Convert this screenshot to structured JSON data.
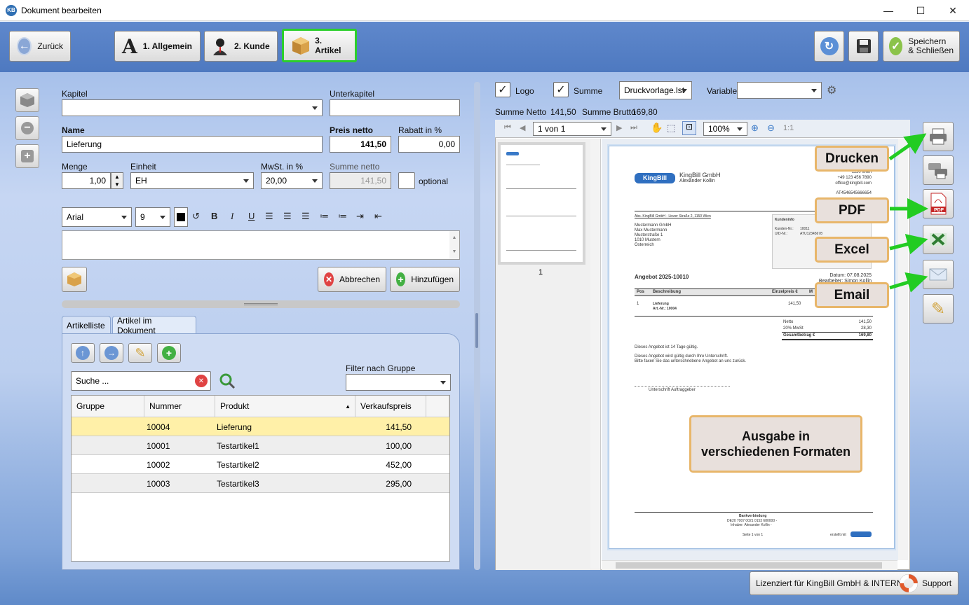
{
  "window": {
    "title": "Dokument bearbeiten",
    "app_icon": "KB",
    "min": "—",
    "max": "☐",
    "close": "✕"
  },
  "toolbar": {
    "back": "Zurück",
    "tab1": "1. Allgemein",
    "tab2": "2. Kunde",
    "tab3": "3. Artikel",
    "save_close": "Speichern\n& Schließen"
  },
  "form": {
    "kapitel_label": "Kapitel",
    "unterkapitel_label": "Unterkapitel",
    "name_label": "Name",
    "name_value": "Lieferung",
    "preis_label": "Preis netto",
    "preis_value": "141,50",
    "rabatt_label": "Rabatt in %",
    "rabatt_value": "0,00",
    "menge_label": "Menge",
    "menge_value": "1,00",
    "einheit_label": "Einheit",
    "einheit_value": "EH",
    "mwst_label": "MwSt. in %",
    "mwst_value": "20,00",
    "summe_label": "Summe netto",
    "summe_value": "141,50",
    "optional_label": "optional",
    "font_value": "Arial",
    "size_value": "9",
    "cancel": "Abbrechen",
    "add": "Hinzufügen"
  },
  "tabs": {
    "t1": "Artikelliste",
    "t2": "Artikel im Dokument"
  },
  "list": {
    "search_value": "Suche ...",
    "filter_label": "Filter nach Gruppe",
    "columns": [
      "Gruppe",
      "Nummer",
      "Produkt",
      "Verkaufspreis"
    ],
    "rows": [
      {
        "gruppe": "",
        "nummer": "10004",
        "produkt": "Lieferung",
        "preis": "141,50"
      },
      {
        "gruppe": "",
        "nummer": "10001",
        "produkt": "Testartikel1",
        "preis": "100,00"
      },
      {
        "gruppe": "",
        "nummer": "10002",
        "produkt": "Testartikel2",
        "preis": "452,00"
      },
      {
        "gruppe": "",
        "nummer": "10003",
        "produkt": "Testartikel3",
        "preis": "295,00"
      }
    ]
  },
  "preview": {
    "logo": "Logo",
    "summe": "Summe",
    "template": "Druckvorlage.lst",
    "variable": "Variable",
    "summe_netto_label": "Summe Netto",
    "summe_netto_value": "141,50",
    "summe_brutto_label": "Summe Brutto",
    "summe_brutto_value": "169,80",
    "page_sel": "1 von 1",
    "zoom": "100%",
    "ratio": "1:1",
    "thumb_num": "1"
  },
  "doc": {
    "logo": "KingBill",
    "company": "KingBill GmbH",
    "person": "Alexander Kollin",
    "city": "1150 Wien",
    "phone": "+49 123 456 7890",
    "mail": "office@kingbill.com",
    "uid": "AT4546545666654",
    "sender": "Abs. KingBill GmbH - Linzer Straße 2, 1150 Wien",
    "addr1": "Mustermann GmbH",
    "addr2": "Max Mustermann",
    "addr3": "Musterstraße 1",
    "addr4": "1010 Mustern",
    "addr5": "Österreich",
    "ki_title": "Kundeninfo",
    "ki_nr_label": "Kunden-Nr.:",
    "ki_nr": "10011",
    "ki_uid_label": "UID-Nr.:",
    "ki_uid": "ATU12345678",
    "offer": "Angebot 2025-10010",
    "date": "Datum: 07.08.2025",
    "editor": "Bearbeiter: Simon Kollin",
    "col_pos": "Pos",
    "col_desc": "Beschreibung",
    "col_unit": "Einzelpreis €",
    "col_m": "M",
    "item_pos": "1",
    "item_name": "Lieferung",
    "item_art": "Art.-Nr.: 10004",
    "item_price": "141,50",
    "netto_label": "Netto",
    "netto": "141,50",
    "mwst_label": "20% MwSt",
    "mwst": "28,30",
    "gesamt_label": "Gesamtbetrag €",
    "gesamt": "169,80",
    "text1": "Dieses Angebot ist 14 Tage gültig.",
    "text2": "Dieses Angebot wird gültig durch Ihre Unterschrift.",
    "text3": "Bitte faxen Sie das unterschriebene Angebot an uns zurück.",
    "sign": "Unterschrift Auftraggeber",
    "bank_title": "Bankverbindung",
    "bank1": "DE20 7007 0021 0153 680000 -",
    "bank2": "Inhaber: Alexander Kollin -",
    "pageinfo": "Seite 1 von 1",
    "created": "erstellt mit"
  },
  "callouts": {
    "print": "Drucken",
    "pdf": "PDF",
    "excel": "Excel",
    "email": "Email",
    "formats": "Ausgabe in\nverschiedenen Formaten"
  },
  "status": {
    "license": "Lizenziert für KingBill GmbH & INTERN",
    "support": "Support"
  },
  "colors": {
    "accent": "#2ccf2c",
    "callout_border": "#e8b66a",
    "arrow": "#22cc22",
    "highlight_row": "#fff0a8"
  }
}
